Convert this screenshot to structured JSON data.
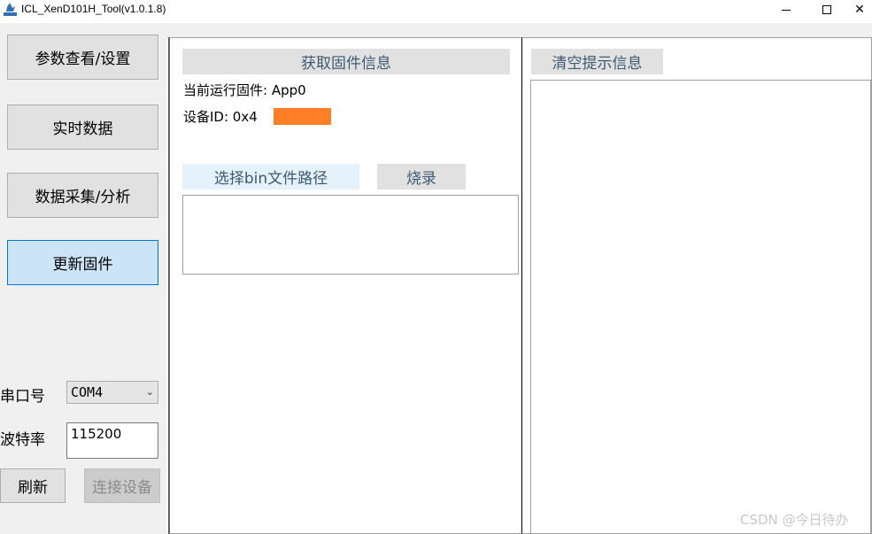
{
  "window": {
    "title": "ICL_XenD101H_Tool(v1.0.1.8)",
    "close_glyph": "✕"
  },
  "nav": {
    "items": [
      {
        "label": "参数查看/设置"
      },
      {
        "label": "实时数据"
      },
      {
        "label": "数据采集/分析"
      },
      {
        "label": "更新固件"
      }
    ]
  },
  "serial": {
    "port_label": "串口号",
    "port_value": "COM4",
    "baud_label": "波特率",
    "baud_value": "115200",
    "refresh_label": "刷新",
    "connect_label": "连接设备"
  },
  "firmware": {
    "get_info_label": "获取固件信息",
    "current_firmware": "当前运行固件: App0",
    "device_id": "设备ID: 0x4",
    "select_bin_label": "选择bin文件路径",
    "flash_label": "烧录"
  },
  "log": {
    "clear_label": "清空提示信息"
  },
  "watermark": "CSDN @今日待办",
  "colors": {
    "active_nav": "#cce4f7",
    "redaction": "#ff7f27"
  }
}
